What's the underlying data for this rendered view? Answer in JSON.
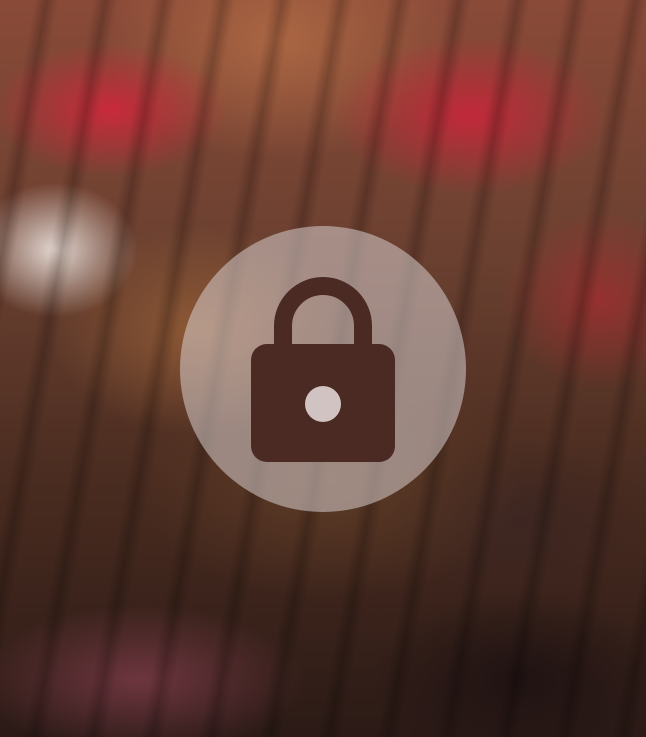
{
  "screen": {
    "type": "locked-media-overlay"
  },
  "background": {
    "description_colors": [
      "#c8263a",
      "#e8ded8",
      "#96603a",
      "#2b1a16"
    ]
  },
  "lock": {
    "icon": "lock-icon",
    "circle_color": "#d7cdcd",
    "icon_color": "#4a2a22"
  }
}
